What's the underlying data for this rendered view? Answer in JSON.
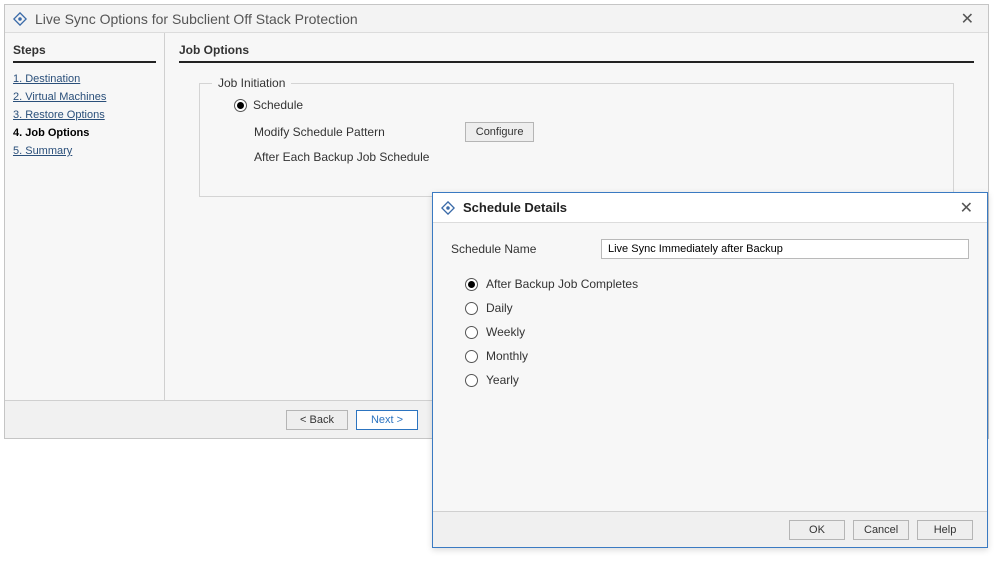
{
  "wizard": {
    "title": "Live Sync Options for Subclient Off Stack Protection",
    "steps_label": "Steps",
    "steps": [
      {
        "label": "1. Destination"
      },
      {
        "label": "2. Virtual Machines"
      },
      {
        "label": "3. Restore Options"
      },
      {
        "label": "4. Job Options"
      },
      {
        "label": "5. Summary"
      }
    ],
    "section_title": "Job Options",
    "job_initiation": {
      "legend": "Job Initiation",
      "schedule_label": "Schedule",
      "modify_label": "Modify Schedule Pattern",
      "configure_label": "Configure",
      "after_label": "After Each Backup Job Schedule"
    },
    "buttons": {
      "back": "< Back",
      "next": "Next >"
    }
  },
  "dialog": {
    "title": "Schedule Details",
    "name_label": "Schedule Name",
    "name_value": "Live Sync Immediately after Backup",
    "frequencies": [
      {
        "label": "After Backup Job Completes",
        "selected": true
      },
      {
        "label": "Daily",
        "selected": false
      },
      {
        "label": "Weekly",
        "selected": false
      },
      {
        "label": "Monthly",
        "selected": false
      },
      {
        "label": "Yearly",
        "selected": false
      }
    ],
    "buttons": {
      "ok": "OK",
      "cancel": "Cancel",
      "help": "Help"
    }
  }
}
